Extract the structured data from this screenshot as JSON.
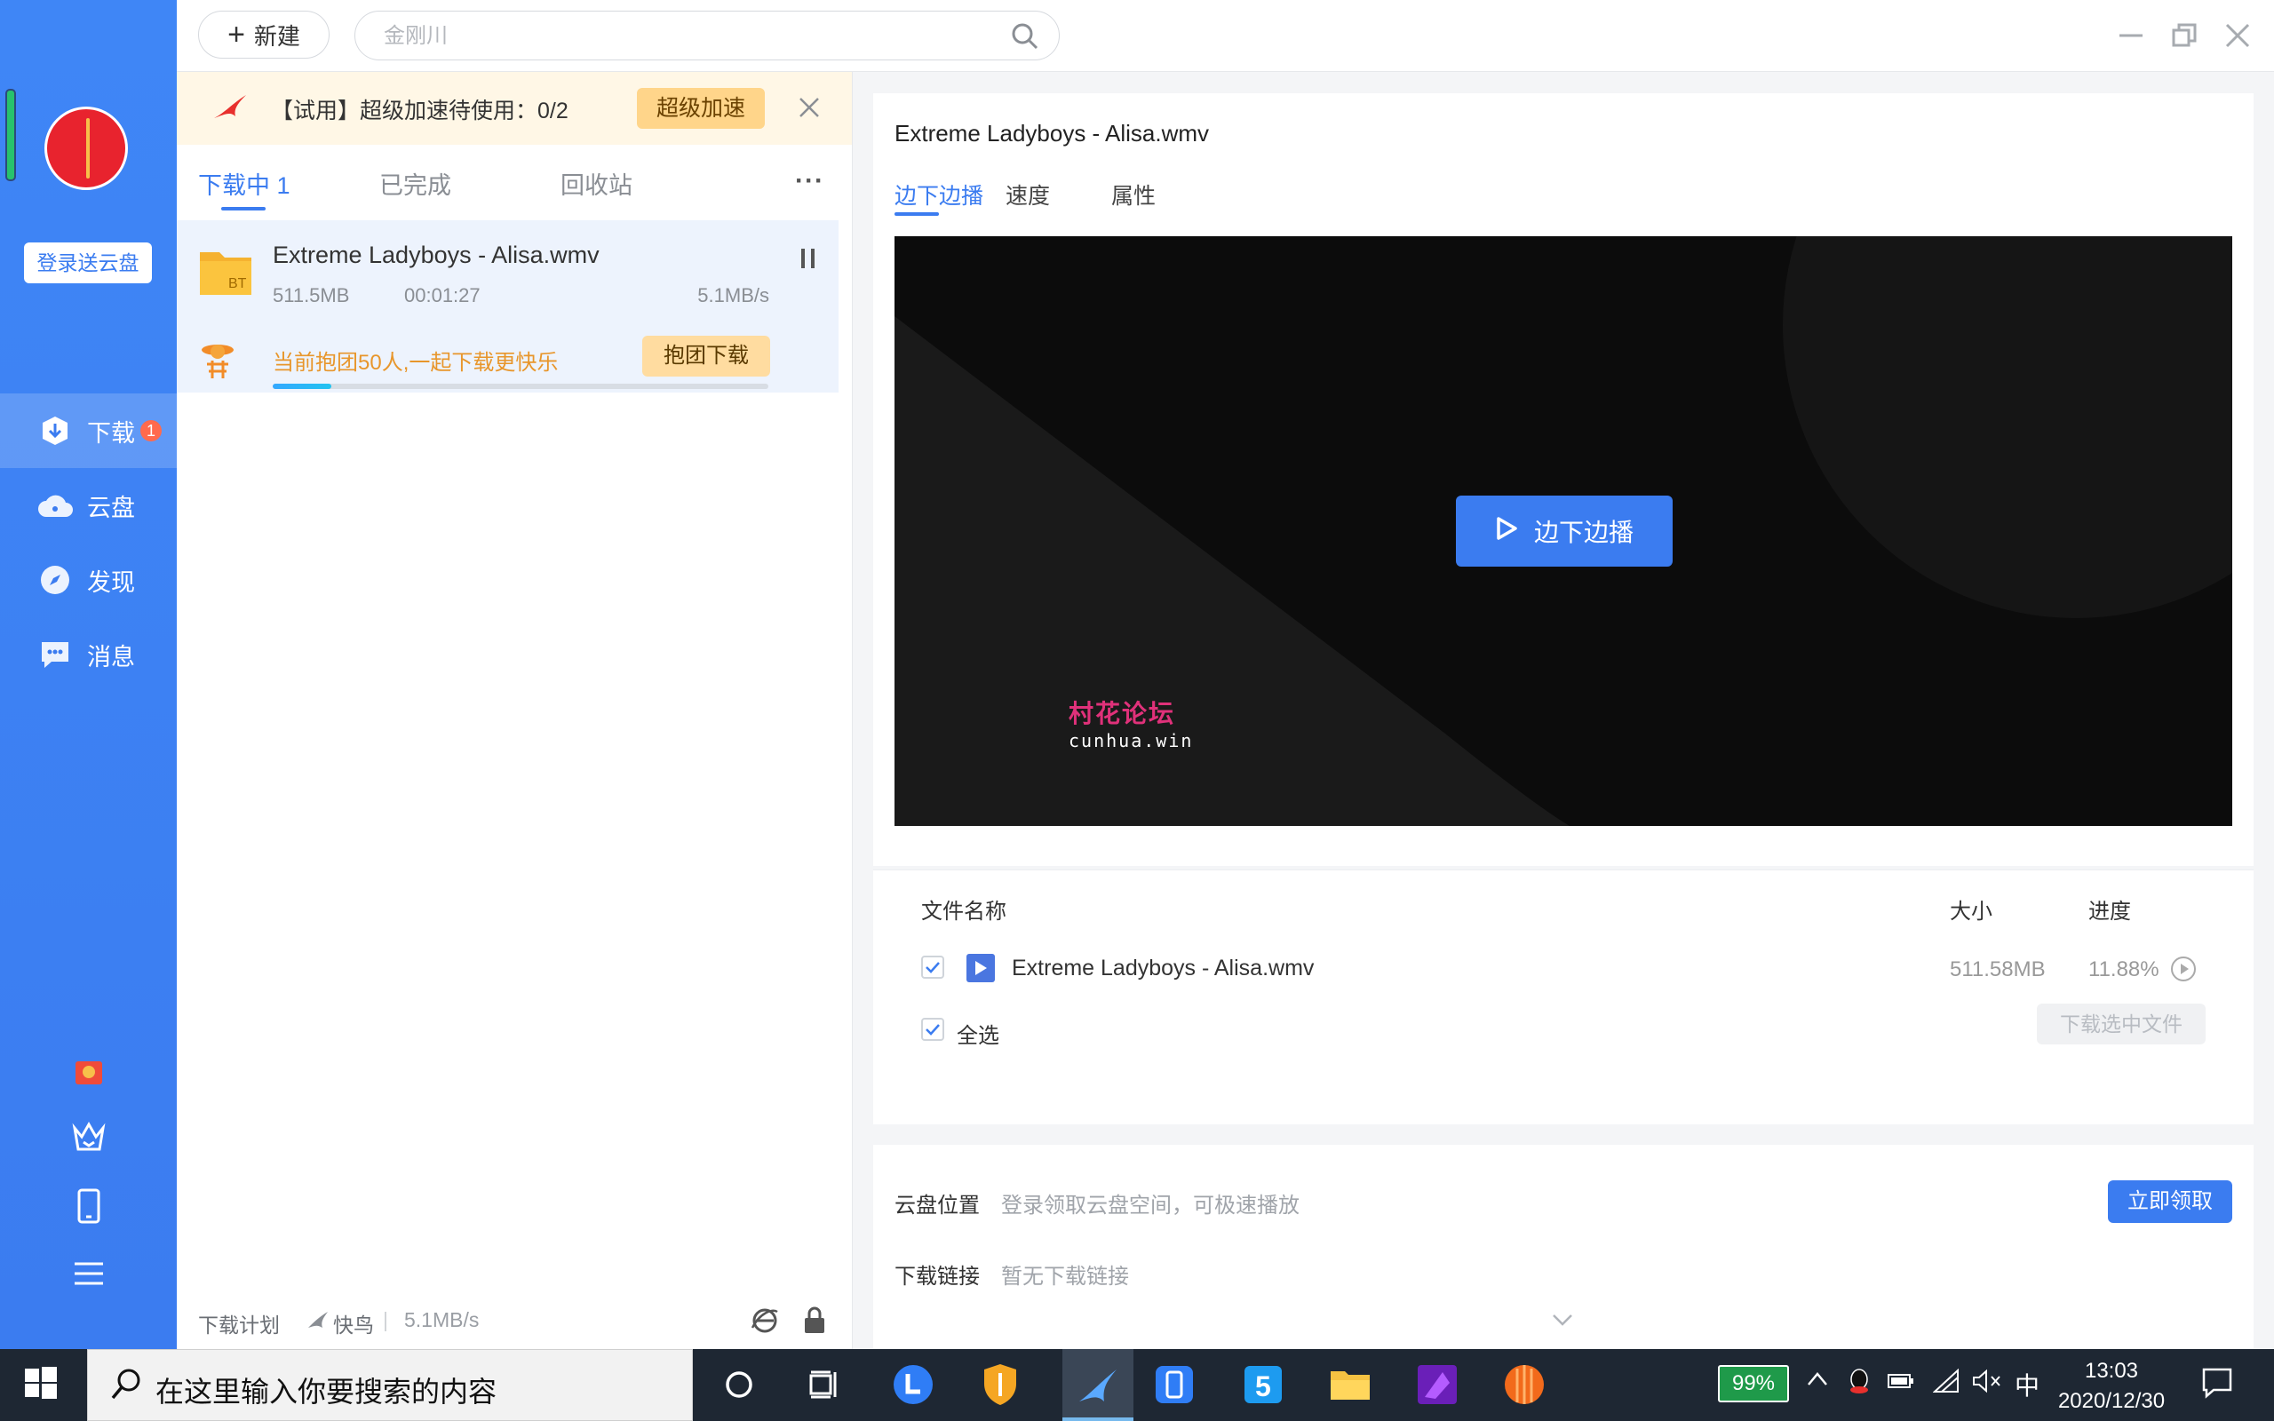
{
  "sidebar": {
    "login_label": "登录送云盘",
    "items": [
      {
        "label": "下载",
        "badge": "1"
      },
      {
        "label": "云盘"
      },
      {
        "label": "发现"
      },
      {
        "label": "消息"
      }
    ]
  },
  "topbar": {
    "new_label": "新建",
    "search_placeholder": "金刚川"
  },
  "trial": {
    "text": "【试用】超级加速待使用：0/2",
    "button": "超级加速"
  },
  "tabs": [
    {
      "label": "下载中 1"
    },
    {
      "label": "已完成"
    },
    {
      "label": "回收站"
    }
  ],
  "more_label": "···",
  "task": {
    "name": "Extreme Ladyboys - Alisa.wmv",
    "size": "511.5MB",
    "time_left": "00:01:27",
    "speed": "5.1MB/s",
    "progress": 0.1188,
    "folder_tag": "BT",
    "group_text": "当前抱团50人,一起下载更快乐",
    "group_button": "抱团下载"
  },
  "statusbar": {
    "plan": "下载计划",
    "mode": "快鸟",
    "speed": "5.1MB/s"
  },
  "detail": {
    "title": "Extreme Ladyboys - Alisa.wmv",
    "tabs": [
      {
        "label": "边下边播"
      },
      {
        "label": "速度"
      },
      {
        "label": "属性"
      }
    ],
    "play_label": "边下边播",
    "watermark_cn": "村花论坛",
    "watermark_en": "cunhua.win"
  },
  "filelist": {
    "col_name": "文件名称",
    "col_size": "大小",
    "col_progress": "进度",
    "row": {
      "name": "Extreme Ladyboys - Alisa.wmv",
      "size": "511.58MB",
      "progress": "11.88%"
    },
    "select_all": "全选",
    "download_selected": "下载选中文件"
  },
  "cloud": {
    "location_label": "云盘位置",
    "location_hint": "登录领取云盘空间，可极速播放",
    "claim_button": "立即领取",
    "link_label": "下载链接",
    "link_value": "暂无下载链接"
  },
  "taskbar": {
    "search_text": "在这里输入你要搜索的内容",
    "battery": "99%",
    "ime": "中",
    "time": "13:03",
    "date": "2020/12/30"
  },
  "colors": {
    "accent": "#3b7cf0",
    "sidebar": "#3f86f6",
    "trial_bg": "#fff7e6",
    "orange_text": "#e8962b"
  }
}
